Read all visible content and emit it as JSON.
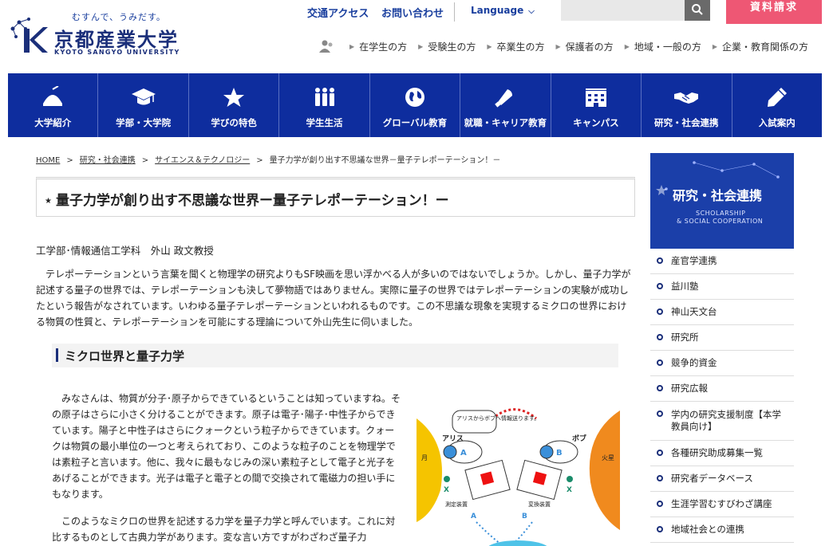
{
  "header": {
    "tagline": "むすんで、うみだす。",
    "logo_name": "京都産業大学",
    "logo_en": "KYOTO SANGYO UNIVERSITY",
    "access_label": "交通アクセス",
    "contact_label": "お問い合わせ",
    "language_label": "Language",
    "search_placeholder": "",
    "request_label": "資料請求"
  },
  "audience": {
    "items": [
      "在学生の方",
      "受験生の方",
      "卒業生の方",
      "保護者の方",
      "地域・一般の方",
      "企業・教育関係の方"
    ]
  },
  "gnav": {
    "items": [
      {
        "label": "大学紹介",
        "icon": "dome-icon"
      },
      {
        "label": "学部・大学院",
        "icon": "graduation-cap-icon"
      },
      {
        "label": "学びの特色",
        "icon": "star-icon"
      },
      {
        "label": "学生生活",
        "icon": "people-icon"
      },
      {
        "label": "グローバル教育",
        "icon": "globe-icon"
      },
      {
        "label": "就職・キャリア教育",
        "icon": "megaphone-icon"
      },
      {
        "label": "キャンパス",
        "icon": "building-icon"
      },
      {
        "label": "研究・社会連携",
        "icon": "handshake-icon"
      },
      {
        "label": "入試案内",
        "icon": "pencil-icon"
      }
    ]
  },
  "breadcrumb": {
    "home": "HOME",
    "c1": "研究・社会連携",
    "c2": "サイエンス＆テクノロジー",
    "current": "量子力学が創り出す不思議な世界－量子テレポーテーション！－",
    "separator": ">"
  },
  "article": {
    "title": "量子力学が創り出す不思議な世界ー量子テレポーテーション！ー",
    "author": "工学部･情報通信工学科　外山 政文教授",
    "lead": "テレポーテーションという言葉を聞くと物理学の研究よりもSF映画を思い浮かべる人が多いのではないでしょうか。しかし、量子力学が記述する量子の世界では、テレポーテーションも決して夢物語ではありません。実際に量子の世界ではテレポーテーションの実験が成功したという報告がなされています。いわゆる量子テレポーテーションといわれるものです。この不思議な現象を実現するミクロの世界における物質の性質と、テレポーテーションを可能にする理論について外山先生に伺いました。",
    "section_title": "ミクロ世界と量子力学",
    "para1": "みなさんは、物質が分子･原子からできているということは知っていますね。その原子はさらに小さく分けることができます。原子は電子･陽子･中性子からできています。陽子と中性子はさらにクォークという粒子からできています。クォークは物質の最小単位の一つと考えられており、このような粒子のことを物理学では素粒子と言います。他に、我々に最もなじみの深い素粒子として電子と光子をあげることができます。光子は電子と電子との間で交換されて電磁力の担い手にもなります。",
    "para2": "このようなミクロの世界を記述する力学を量子力学と呼んでいます。これに対比するものとして古典力学があります。変な言い方ですがわざわざ量子力"
  },
  "illustration": {
    "alice": "アリス",
    "bob": "ボブ",
    "bubble": "アリスからボブへ情報送ります。",
    "moon": "月",
    "mars": "火星",
    "label_a": "A",
    "label_b": "B",
    "label_x": "X",
    "device_left": "測定装置",
    "device_right": "変換装置"
  },
  "sidebar": {
    "banner_title": "研究・社会連携",
    "banner_sub1": "SCHOLARSHIP",
    "banner_sub2": "& SOCIAL COOPERATION",
    "items": [
      "産官学連携",
      "益川塾",
      "神山天文台",
      "研究所",
      "競争的資金",
      "研究広報",
      "学内の研究支援制度【本学教員向け】",
      "各種研究助成募集一覧",
      "研究者データベース",
      "生涯学習むすびわざ講座",
      "地域社会との連携"
    ]
  }
}
